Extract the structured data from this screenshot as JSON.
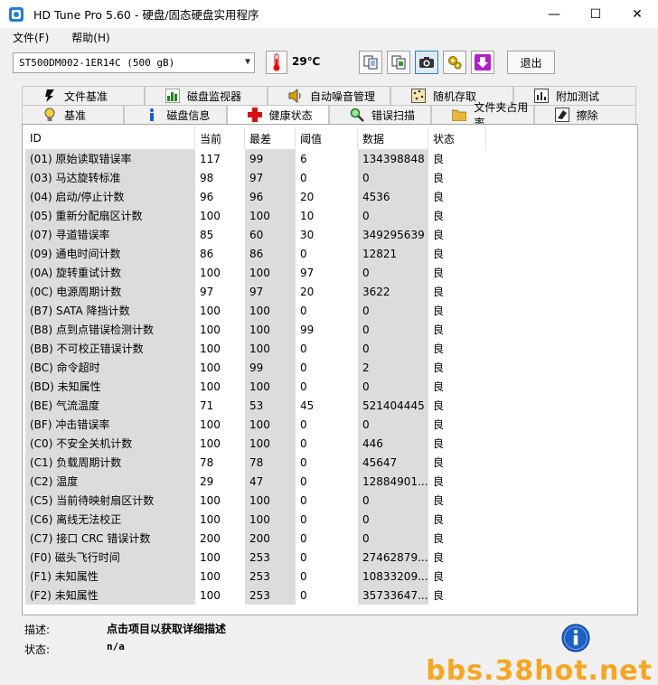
{
  "window": {
    "title": "HD Tune Pro 5.60 - 硬盘/固态硬盘实用程序",
    "minimize": "—",
    "maximize": "☐",
    "close": "✕"
  },
  "menu": [
    "文件(F)",
    "帮助(H)"
  ],
  "toolbar": {
    "drive": "ST500DM002-1ER14C (500 gB)",
    "temperature": "29℃",
    "exit_label": "退出"
  },
  "tabs_row1": [
    "文件基准",
    "磁盘监视器",
    "自动噪音管理",
    "随机存取",
    "附加测试"
  ],
  "tabs_row2": [
    "基准",
    "磁盘信息",
    "健康状态",
    "错误扫描",
    "文件夹占用率",
    "擦除"
  ],
  "table": {
    "headers": [
      "ID",
      "当前",
      "最差",
      "阈值",
      "数据",
      "状态"
    ],
    "rows": [
      [
        "(01) 原始读取错误率",
        "117",
        "99",
        "6",
        "134398848",
        "良"
      ],
      [
        "(03) 马达旋转标准",
        "98",
        "97",
        "0",
        "0",
        "良"
      ],
      [
        "(04) 启动/停止计数",
        "96",
        "96",
        "20",
        "4536",
        "良"
      ],
      [
        "(05) 重新分配扇区计数",
        "100",
        "100",
        "10",
        "0",
        "良"
      ],
      [
        "(07) 寻道错误率",
        "85",
        "60",
        "30",
        "349295639",
        "良"
      ],
      [
        "(09) 通电时间计数",
        "86",
        "86",
        "0",
        "12821",
        "良"
      ],
      [
        "(0A) 旋转重试计数",
        "100",
        "100",
        "97",
        "0",
        "良"
      ],
      [
        "(0C) 电源周期计数",
        "97",
        "97",
        "20",
        "3622",
        "良"
      ],
      [
        "(B7) SATA 降挡计数",
        "100",
        "100",
        "0",
        "0",
        "良"
      ],
      [
        "(B8) 点到点错误检测计数",
        "100",
        "100",
        "99",
        "0",
        "良"
      ],
      [
        "(BB) 不可校正错误计数",
        "100",
        "100",
        "0",
        "0",
        "良"
      ],
      [
        "(BC) 命令超时",
        "100",
        "99",
        "0",
        "2",
        "良"
      ],
      [
        "(BD) 未知属性",
        "100",
        "100",
        "0",
        "0",
        "良"
      ],
      [
        "(BE) 气流温度",
        "71",
        "53",
        "45",
        "521404445",
        "良"
      ],
      [
        "(BF) 冲击错误率",
        "100",
        "100",
        "0",
        "0",
        "良"
      ],
      [
        "(C0) 不安全关机计数",
        "100",
        "100",
        "0",
        "446",
        "良"
      ],
      [
        "(C1) 负载周期计数",
        "78",
        "78",
        "0",
        "45647",
        "良"
      ],
      [
        "(C2) 温度",
        "29",
        "47",
        "0",
        "12884901...",
        "良"
      ],
      [
        "(C5) 当前待映射扇区计数",
        "100",
        "100",
        "0",
        "0",
        "良"
      ],
      [
        "(C6) 离线无法校正",
        "100",
        "100",
        "0",
        "0",
        "良"
      ],
      [
        "(C7) 接口 CRC 错误计数",
        "200",
        "200",
        "0",
        "0",
        "良"
      ],
      [
        "(F0) 磁头飞行时间",
        "100",
        "253",
        "0",
        "27462879...",
        "良"
      ],
      [
        "(F1) 未知属性",
        "100",
        "253",
        "0",
        "10833209...",
        "良"
      ],
      [
        "(F2) 未知属性",
        "100",
        "253",
        "0",
        "35733647...",
        "良"
      ]
    ]
  },
  "footer": {
    "desc_label": "描述:",
    "desc_value": "点击项目以获取详细描述",
    "status_label": "状态:",
    "status_value": "n/a"
  },
  "watermark": "bbs.38hot.net"
}
